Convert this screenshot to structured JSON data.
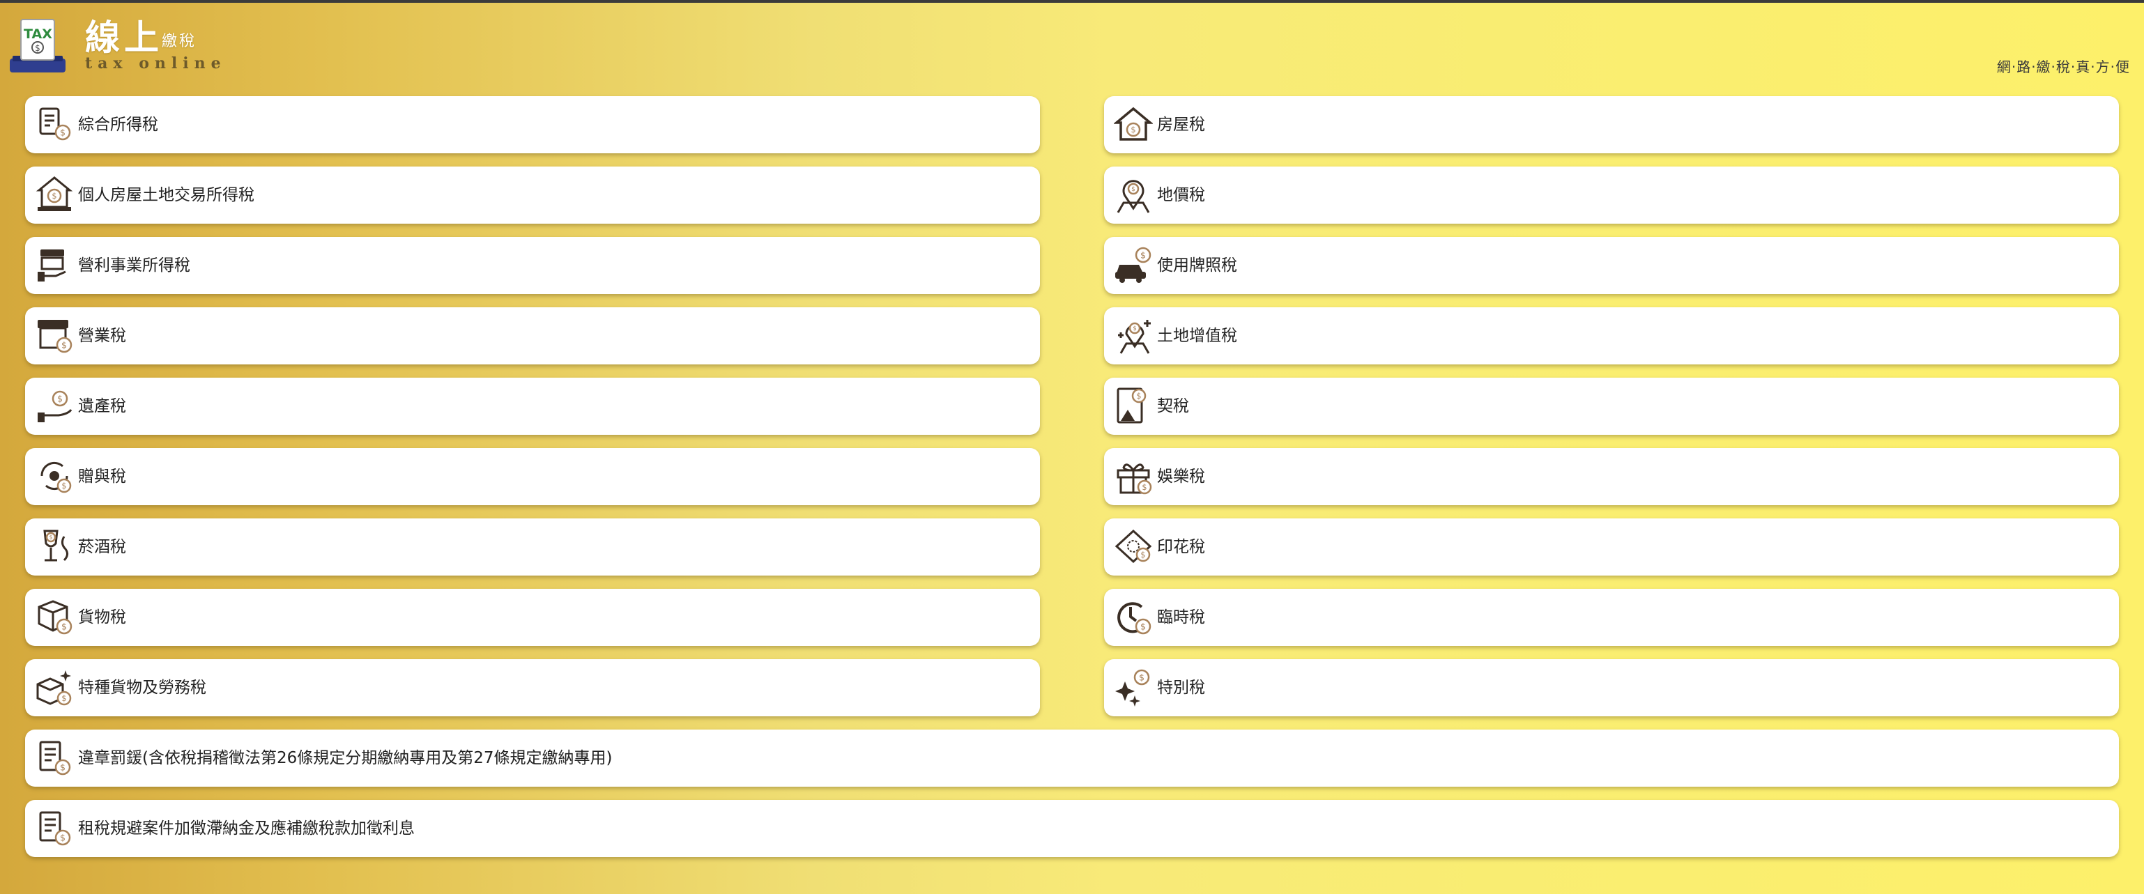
{
  "header": {
    "logo_badge": "TAX",
    "title_main": "線上",
    "title_sub": "繳稅",
    "title_en": "tax online",
    "slogan": "網·路·繳·稅·真·方·便"
  },
  "colors": {
    "icon_dark": "#3a2e25",
    "icon_coin": "#a8825a",
    "card_bg": "#ffffff",
    "bg_left": "#d4a83c",
    "bg_right": "#fdf06a"
  },
  "left_items": [
    {
      "label": "綜合所得稅",
      "icon": "receipt-coin-icon"
    },
    {
      "label": "個人房屋土地交易所得稅",
      "icon": "house-deal-icon"
    },
    {
      "label": "營利事業所得稅",
      "icon": "shop-hand-icon"
    },
    {
      "label": "營業稅",
      "icon": "storefront-icon"
    },
    {
      "label": "遺產稅",
      "icon": "hand-coin-icon"
    },
    {
      "label": "贈與稅",
      "icon": "gift-exchange-icon"
    },
    {
      "label": "菸酒稅",
      "icon": "wine-smoke-icon"
    },
    {
      "label": "貨物稅",
      "icon": "package-coin-icon"
    },
    {
      "label": "特種貨物及勞務稅",
      "icon": "package-sparkle-icon"
    }
  ],
  "right_items": [
    {
      "label": "房屋稅",
      "icon": "house-coin-icon"
    },
    {
      "label": "地價稅",
      "icon": "map-pin-coin-icon"
    },
    {
      "label": "使用牌照稅",
      "icon": "car-coin-icon"
    },
    {
      "label": "土地增值稅",
      "icon": "pin-plus-icon"
    },
    {
      "label": "契稅",
      "icon": "deed-document-icon"
    },
    {
      "label": "娛樂稅",
      "icon": "gift-box-icon"
    },
    {
      "label": "印花稅",
      "icon": "stamp-ticket-icon"
    },
    {
      "label": "臨時稅",
      "icon": "clock-coin-icon"
    },
    {
      "label": "特別稅",
      "icon": "sparkle-coin-icon"
    }
  ],
  "full_items": [
    {
      "label": "違章罰鍰(含依稅捐稽徵法第26條規定分期繳納專用及第27條規定繳納專用)",
      "icon": "invoice-coin-icon"
    },
    {
      "label": "租稅規避案件加徵滯納金及應補繳稅款加徵利息",
      "icon": "invoice-coin-icon"
    }
  ]
}
